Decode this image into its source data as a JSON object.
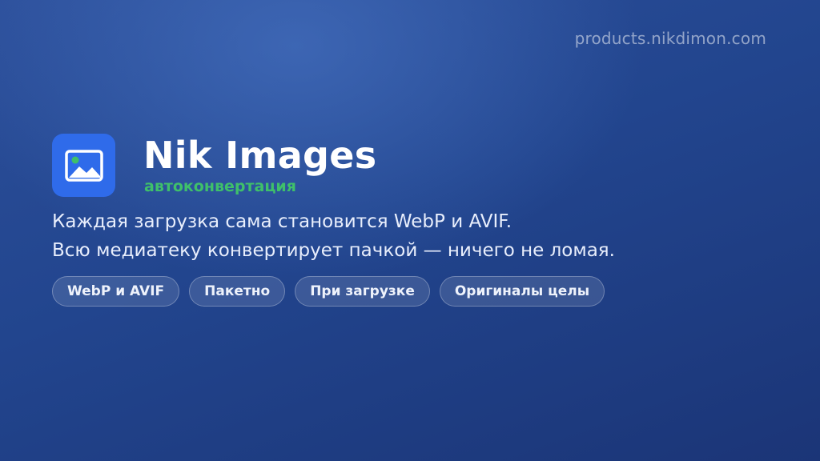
{
  "header": {
    "domain": "products.nikdimon.com"
  },
  "app": {
    "icon": "image-icon",
    "title": "Nik Images",
    "subtitle": "автоконвертация"
  },
  "description": {
    "line1": "Каждая загрузка сама становится WebP и AVIF.",
    "line2": "Всю медиатеку конвертирует пачкой — ничего не ломая."
  },
  "chips": [
    {
      "label": "WebP и AVIF"
    },
    {
      "label": "Пакетно"
    },
    {
      "label": "При загрузке"
    },
    {
      "label": "Оригиналы целы"
    }
  ],
  "colors": {
    "accent": "#2f6bea",
    "subtitle": "#3fc06a",
    "background": "#22458e"
  }
}
